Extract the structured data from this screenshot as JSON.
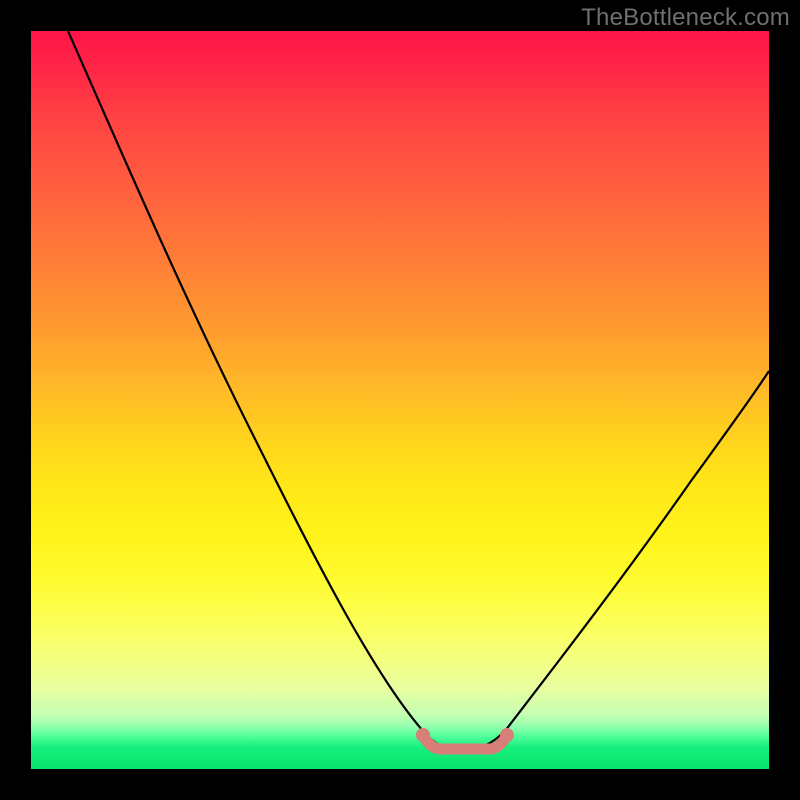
{
  "watermark": {
    "text": "TheBottleneck.com"
  },
  "colors": {
    "background": "#000000",
    "curve_stroke": "#000000",
    "optimum_stroke": "#d87f7a",
    "gradient_stops": [
      "#ff1447",
      "#ff2a47",
      "#ff4343",
      "#ff5a3f",
      "#ff7a38",
      "#ff9a30",
      "#ffb828",
      "#ffd51c",
      "#ffe818",
      "#fff21a",
      "#fffb2e",
      "#fcff56",
      "#f4ff7e",
      "#e8ffa0",
      "#c8ffb2",
      "#9effb0",
      "#54ff9a",
      "#18f07e",
      "#06e46a"
    ]
  },
  "chart_data": {
    "type": "line",
    "title": "",
    "xlabel": "",
    "ylabel": "",
    "xlim": [
      0,
      100
    ],
    "ylim": [
      0,
      100
    ],
    "grid": false,
    "series": [
      {
        "name": "bottleneck-curve",
        "x": [
          5,
          10,
          15,
          20,
          25,
          30,
          35,
          40,
          45,
          50,
          53,
          55,
          58,
          60,
          62,
          65,
          70,
          75,
          80,
          85,
          90,
          95,
          100
        ],
        "y": [
          100,
          90,
          80,
          70,
          60,
          50,
          40,
          30,
          20,
          10,
          4,
          1,
          0,
          0,
          1,
          4,
          12,
          22,
          32,
          42,
          51,
          58,
          64
        ]
      }
    ],
    "optimum_zone": {
      "x_start": 53,
      "x_end": 64,
      "y": 1.5,
      "endpoint_dots": true,
      "description": "flat segment at curve minimum highlighted in salmon"
    },
    "annotations": [
      {
        "text": "TheBottleneck.com",
        "position": "top-right"
      }
    ]
  }
}
